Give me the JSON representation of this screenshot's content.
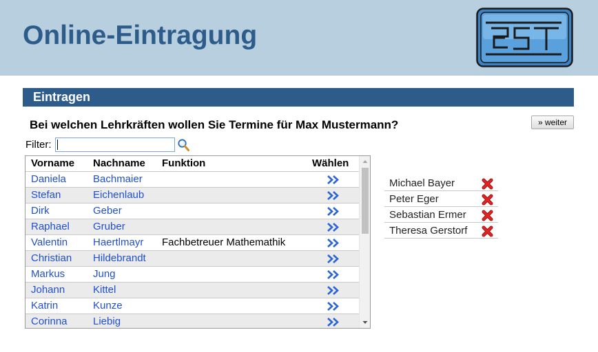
{
  "header": {
    "title": "Online-Eintragung",
    "logo_text": "est"
  },
  "section": {
    "title": "Eintragen"
  },
  "question": "Bei welchen Lehrkräften wollen Sie Termine für Max Mustermann?",
  "weiter_label": "» weiter",
  "filter": {
    "label": "Filter:",
    "value": ""
  },
  "table": {
    "headers": {
      "vorname": "Vorname",
      "nachname": "Nachname",
      "funktion": "Funktion",
      "waehlen": "Wählen"
    },
    "rows": [
      {
        "vorname": "Daniela",
        "nachname": "Bachmaier",
        "funktion": ""
      },
      {
        "vorname": "Stefan",
        "nachname": "Eichenlaub",
        "funktion": ""
      },
      {
        "vorname": "Dirk",
        "nachname": "Geber",
        "funktion": ""
      },
      {
        "vorname": "Raphael",
        "nachname": "Gruber",
        "funktion": ""
      },
      {
        "vorname": "Valentin",
        "nachname": "Haertlmayr",
        "funktion": "Fachbetreuer Mathemathik"
      },
      {
        "vorname": "Christian",
        "nachname": "Hildebrandt",
        "funktion": ""
      },
      {
        "vorname": "Markus",
        "nachname": "Jung",
        "funktion": ""
      },
      {
        "vorname": "Johann",
        "nachname": "Kittel",
        "funktion": ""
      },
      {
        "vorname": "Katrin",
        "nachname": "Kunze",
        "funktion": ""
      },
      {
        "vorname": "Corinna",
        "nachname": "Liebig",
        "funktion": ""
      }
    ],
    "choose_icon": "double-chevron-right-icon",
    "scroll_position": 0.0
  },
  "selected": [
    {
      "name": "Michael Bayer"
    },
    {
      "name": "Peter Eger"
    },
    {
      "name": "Sebastian Ermer"
    },
    {
      "name": "Theresa Gerstorf"
    }
  ],
  "colors": {
    "header_bg": "#b8cfe0",
    "brand_blue": "#2e5c8a",
    "link_blue": "#1f4fcf",
    "remove_red": "#e02424"
  }
}
